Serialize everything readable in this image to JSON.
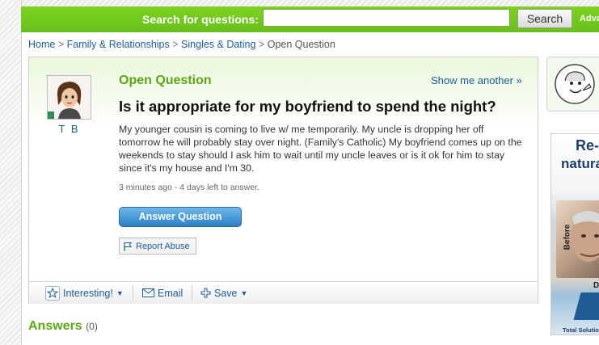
{
  "search": {
    "label": "Search for questions:",
    "placeholder": "",
    "button_label": "Search",
    "advanced_label": "Adva"
  },
  "breadcrumb": {
    "items": [
      "Home",
      "Family & Relationships",
      "Singles & Dating"
    ],
    "current": "Open Question",
    "separator": ">"
  },
  "question": {
    "status_label": "Open Question",
    "show_another_label": "Show me another »",
    "title": "Is it appropriate for my boyfriend to spend the night?",
    "body": "My younger cousin is coming to live w/ me temporarily. My uncle is dropping her off tomorrow he will probably stay over night. (Family's Catholic) My boyfriend comes up on the weekends to stay should I ask him to wait until my uncle leaves or is it ok for him to stay since it's my house and I'm 30.",
    "meta": "3 minutes ago - 4 days left to answer.",
    "answer_button_label": "Answer Question",
    "report_abuse_label": "Report Abuse"
  },
  "asker": {
    "name": "T B",
    "avatar_icon": "asker-avatar-icon"
  },
  "actions": {
    "interesting_label": "Interesting!",
    "email_label": "Email",
    "save_label": "Save"
  },
  "answers": {
    "heading": "Answers",
    "count": "(0)"
  },
  "ad": {
    "line1": "Re-",
    "line2": "natura",
    "before_label": "Before",
    "corner_letter": "D",
    "footer": "Total Solutio"
  },
  "colors": {
    "brand_green": "#7ed321",
    "heading_green": "#5aa614",
    "link_blue": "#1a5e9c",
    "button_blue": "#2d7fc4"
  }
}
